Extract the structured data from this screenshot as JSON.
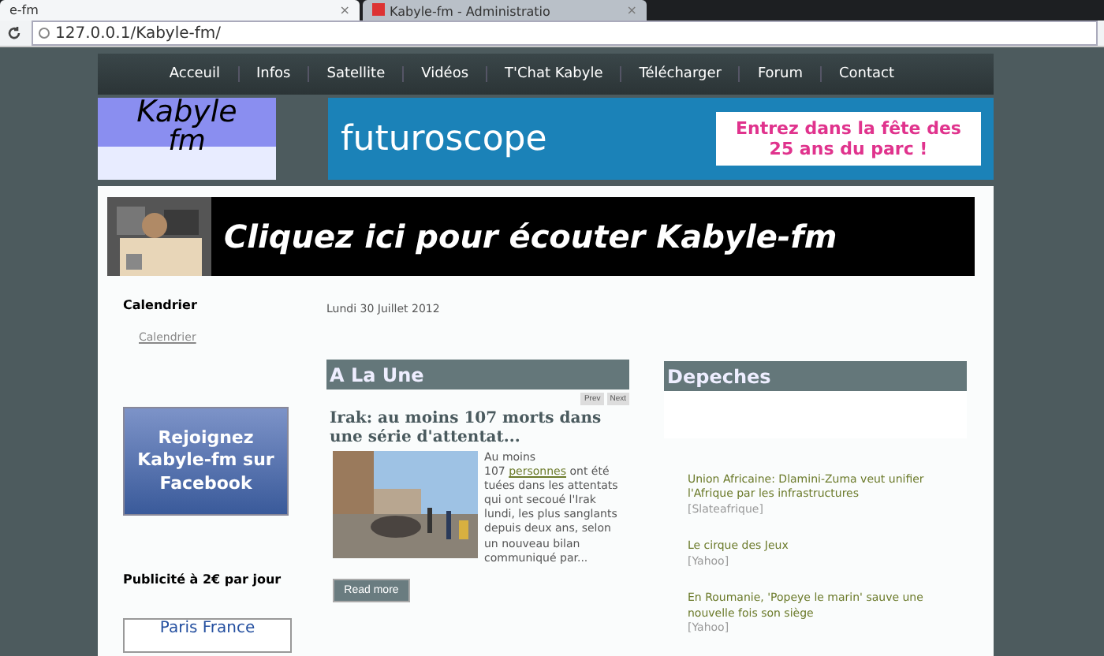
{
  "browser": {
    "tabs": [
      {
        "label": "e-fm",
        "selected": true,
        "close": "×"
      },
      {
        "label": "Kabyle-fm - Administratio",
        "selected": false,
        "close": "×"
      }
    ],
    "address": "127.0.0.1/Kabyle-fm/"
  },
  "nav": [
    "Acceuil",
    "Infos",
    "Satellite",
    "Vidéos",
    "T'Chat Kabyle",
    "Télécharger",
    "Forum",
    "Contact"
  ],
  "logo": {
    "line1": "Kabyle",
    "line2": "fm"
  },
  "ad": {
    "brand": "futuroscope",
    "slogan": "Entrez dans la fête des 25 ans du parc !"
  },
  "listen_banner": {
    "text": "Cliquez ici pour écouter Kabyle-fm"
  },
  "sidebar": {
    "calendar_title": "Calendrier",
    "calendar_link": "Calendrier",
    "facebook": "Rejoignez Kabyle-fm sur Facebook",
    "ads_title": "Publicité à 2€ par jour",
    "ad_text": "Paris France"
  },
  "date": "Lundi 30 Juillet 2012",
  "headlines": {
    "title": "A La Une",
    "prev": "Prev",
    "next": "Next",
    "article": {
      "title": "Irak: au moins 107 morts dans une série d'attentat...",
      "lead": "Au moins",
      "count": "107",
      "link": "personnes",
      "body": "ont été tuées dans les attentats qui ont secoué l'Irak lundi, les plus sanglants depuis deux ans, selon un nouveau bilan communiqué par...",
      "button": "Read more"
    }
  },
  "news": {
    "title": "Depeches",
    "items": [
      {
        "title": "Union Africaine: Dlamini-Zuma veut unifier l'Afrique par les infrastructures",
        "source": "[Slateafrique]"
      },
      {
        "title": "Le cirque des Jeux",
        "source": "[Yahoo]"
      },
      {
        "title": "En Roumanie, 'Popeye le marin' sauve une nouvelle fois son siège",
        "source": "[Yahoo]"
      }
    ]
  }
}
